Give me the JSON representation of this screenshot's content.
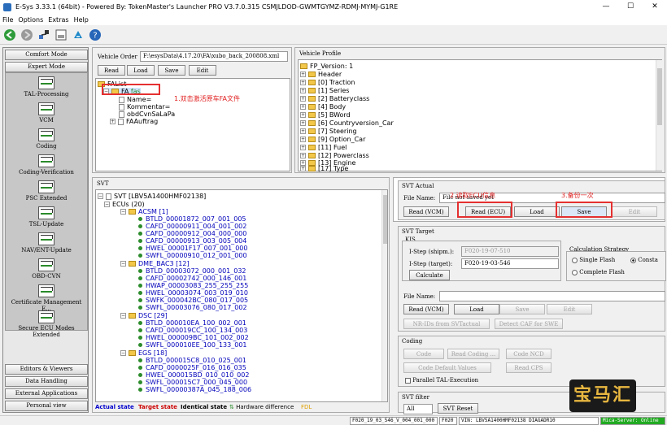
{
  "window": {
    "title": "E-Sys 3.33.1  (64bit) - Powered By: TokenMaster's Launcher PRO V3.7.0.315  CSMJLDOD-GWMTGYMZ-RDMJ-MYMJ-G1RE",
    "controls": [
      "—",
      "☐",
      "✕"
    ]
  },
  "menu": [
    "File",
    "Options",
    "Extras",
    "Help"
  ],
  "toolbar": {
    "icons": [
      "back-icon",
      "forward-icon",
      "connect-icon",
      "disk-icon",
      "esys-icon",
      "help-icon"
    ]
  },
  "leftnav": {
    "comfort": "Comfort Mode",
    "expert": "Expert Mode",
    "items": [
      "TAL-Processing",
      "VCM",
      "Coding",
      "Coding-Verification",
      "PSC Extended",
      "TSL-Update",
      "NAV/ENT-Update",
      "OBD-CVN",
      "Certificate Management E...",
      "Secure ECU Modes Extended"
    ],
    "bottom": [
      "Editors & Viewers",
      "Data Handling",
      "External Applications",
      "Personal view"
    ]
  },
  "vehicle_order": {
    "label": "Vehicle Order",
    "path": "F:\\esysData\\4.17.20\\FA\\xubo_back_200808.xml",
    "buttons": [
      "Read",
      "Load",
      "Save",
      "Edit"
    ],
    "tree": {
      "root": "FAList",
      "fa": "FA",
      "fa_suffix": "fas",
      "children": [
        "Name=",
        "Kommentar=",
        "obdCvnSaLaPa",
        "FAAuftrag"
      ]
    },
    "annotation": "1.双击激活原车FA文件"
  },
  "vehicle_profile": {
    "label": "Vehicle Profile",
    "root": "FP_Version: 1",
    "items": [
      "Header",
      "[0] Traction",
      "[1] Series",
      "[2] Batteryclass",
      "[4] Body",
      "[5] BWord",
      "[6] Countryversion_Car",
      "[7] Steering",
      "[9] Option_Car",
      "[11] Fuel",
      "[12] Powerclass",
      "[13] Engine",
      "[17] Type"
    ]
  },
  "svt": {
    "label": "SVT",
    "root": "SVT  [LBV5A1400HMF02138]",
    "ecus_label": "ECUs (20)",
    "groups": [
      {
        "name": "ACSM  [1]",
        "items": [
          "BTLD_00001872_007_001_005",
          "CAFD_00000911_004_001_002",
          "CAFD_00000912_004_000_000",
          "CAFD_00000913_003_005_004",
          "HWEL_00001F17_007_001_000",
          "SWFL_00000910_012_001_000"
        ]
      },
      {
        "name": "DME_BAC3  [12]",
        "items": [
          "BTLD_00003072_000_001_032",
          "CAFD_00002742_000_146_001",
          "HWAP_00003083_255_255_255",
          "HWEL_00003074_003_019_010",
          "SWFK_000042BC_080_017_005",
          "SWFL_00003076_080_017_002"
        ]
      },
      {
        "name": "DSC  [29]",
        "items": [
          "BTLD_000010EA_100_002_001",
          "CAFD_000019CC_100_134_003",
          "HWEL_000009BC_101_002_002",
          "SWFL_000010EE_100_133_001"
        ]
      },
      {
        "name": "EGS  [18]",
        "items": [
          "BTLD_000015C8_010_025_001",
          "CAFD_0000025F_016_016_035",
          "HWEL_000015BD_010_010_002",
          "SWFL_000015C7_000_045_000",
          "SWFL_00000387A_045_188_006"
        ]
      }
    ],
    "legend": {
      "actual": "Actual state",
      "target": "Target state",
      "identical": "Identical state",
      "hw_diff": "Hardware difference",
      "fdl": "FDL"
    }
  },
  "svt_actual": {
    "label": "SVT Actual",
    "file_label": "File Name:",
    "file_value": "File not saved yet",
    "buttons": [
      "Read (VCM)",
      "Read (ECU)",
      "Load",
      "Save",
      "Edit"
    ],
    "annotation_read": "2.读取ECU信息",
    "annotation_save": "3.备份一次"
  },
  "svt_target": {
    "label": "SVT Target",
    "kis_label": "KIS",
    "istep_shipm_label": "I-Step (shipm.):",
    "istep_shipm_value": "F020-19-07-510",
    "istep_target_label": "I-Step (target):",
    "istep_target_value": "F020-19-03-546",
    "calculate": "Calculate",
    "calc_strategy_label": "Calculation Strategy",
    "single_flash": "Single Flash",
    "complete_flash": "Complete Flash",
    "const": "Consta",
    "file_label": "File Name:",
    "file_value": "",
    "buttons": [
      "Read (VCM)",
      "Load",
      "Save",
      "Edit"
    ],
    "nr_ids": "NR-IDs from SVTactual",
    "detect_caf": "Detect CAF for SWE"
  },
  "coding": {
    "label": "Coding",
    "code": "Code",
    "read_coding": "Read Coding ...",
    "code_nCD": "Code NCD",
    "code_default": "Code Default Values",
    "read_cps": "Read CPS",
    "parallel": "Parallel TAL-Execution"
  },
  "svt_filter": {
    "label": "SVT filter",
    "select_value": "All",
    "reset": "SVT Reset"
  },
  "statusbar": {
    "cell1": "F020_19_03_546_V_004_001_000",
    "cell2": "F020",
    "cell3": "VIN: LBV5A1400HMF02138 DIAGADR10",
    "cell4": "Mica-Server: Online"
  },
  "watermark": "宝马汇",
  "colors": {
    "accent_red": "#e53030",
    "ecu_blue": "#0000bb",
    "actual_state": "#0000cc",
    "target_state": "#cc0000",
    "fdl": "#e0a000",
    "status_green": "#22aa22"
  }
}
